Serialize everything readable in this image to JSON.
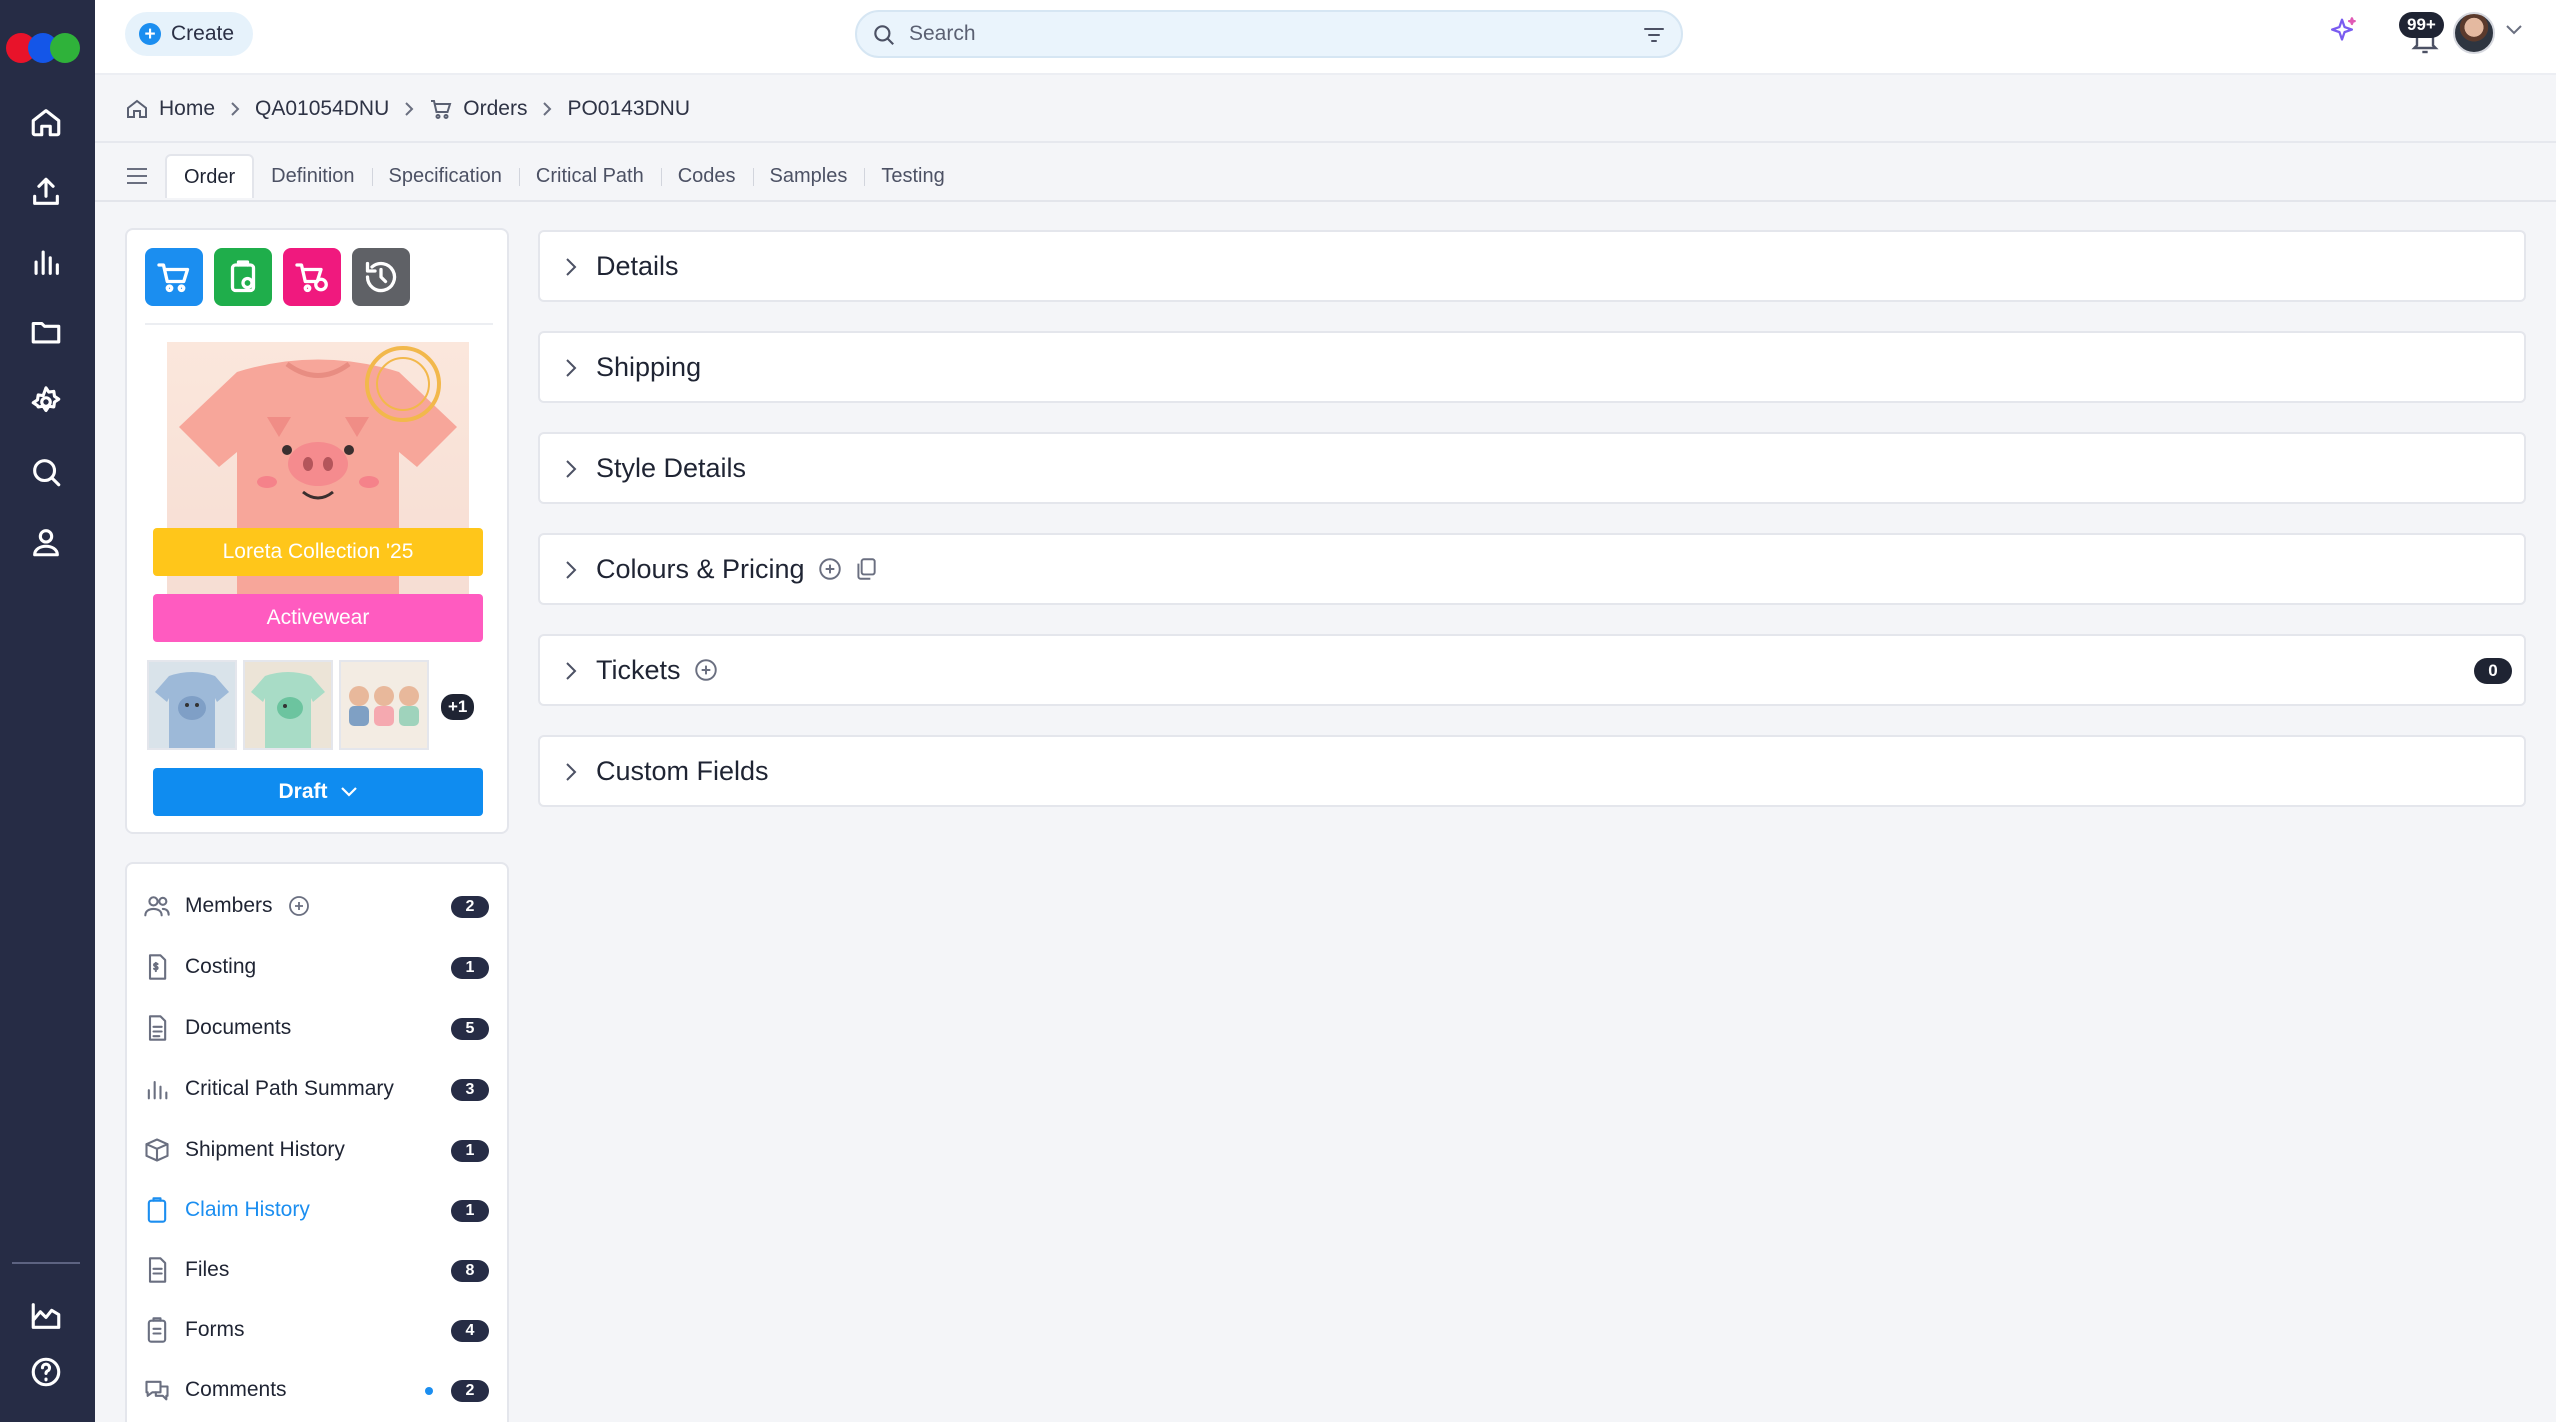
{
  "colors": {
    "rail": "#262c45",
    "accent": "#1b8ef0",
    "tag_collection": "#ffc61a",
    "tag_category": "#ff5bc0",
    "status_button": "#0f8cf0",
    "quick_action_orders": "#1b8ef0",
    "quick_action_claims": "#1fae4b",
    "quick_action_returns": "#f0197e",
    "quick_action_history": "#5f6166"
  },
  "rail": {
    "icons": [
      "home-icon",
      "upload-icon",
      "chart-icon",
      "folder-icon",
      "settings-icon",
      "search-icon",
      "user-icon",
      "analytics-icon",
      "help-icon"
    ]
  },
  "topbar": {
    "create_label": "Create",
    "search_placeholder": "Search",
    "notifications_badge": "99+"
  },
  "breadcrumb": {
    "home": "Home",
    "project": "QA01054DNU",
    "orders": "Orders",
    "order": "PO0143DNU"
  },
  "tabs": [
    "Order",
    "Definition",
    "Specification",
    "Critical Path",
    "Codes",
    "Samples",
    "Testing"
  ],
  "active_tab": "Order",
  "product": {
    "collection_tag": "Loreta Collection '25",
    "category_tag": "Activewear",
    "more_images": "+1",
    "status": "Draft"
  },
  "side_menu": [
    {
      "label": "Members",
      "count": "2"
    },
    {
      "label": "Costing",
      "count": "1"
    },
    {
      "label": "Documents",
      "count": "5"
    },
    {
      "label": "Critical Path Summary",
      "count": "3"
    },
    {
      "label": "Shipment History",
      "count": "1"
    },
    {
      "label": "Claim History",
      "count": "1"
    },
    {
      "label": "Files",
      "count": "8"
    },
    {
      "label": "Forms",
      "count": "4"
    },
    {
      "label": "Comments",
      "count": "2"
    }
  ],
  "sections": [
    {
      "title": "Details"
    },
    {
      "title": "Shipping"
    },
    {
      "title": "Style Details"
    },
    {
      "title": "Colours & Pricing"
    },
    {
      "title": "Tickets",
      "count": "0"
    },
    {
      "title": "Custom Fields"
    }
  ]
}
